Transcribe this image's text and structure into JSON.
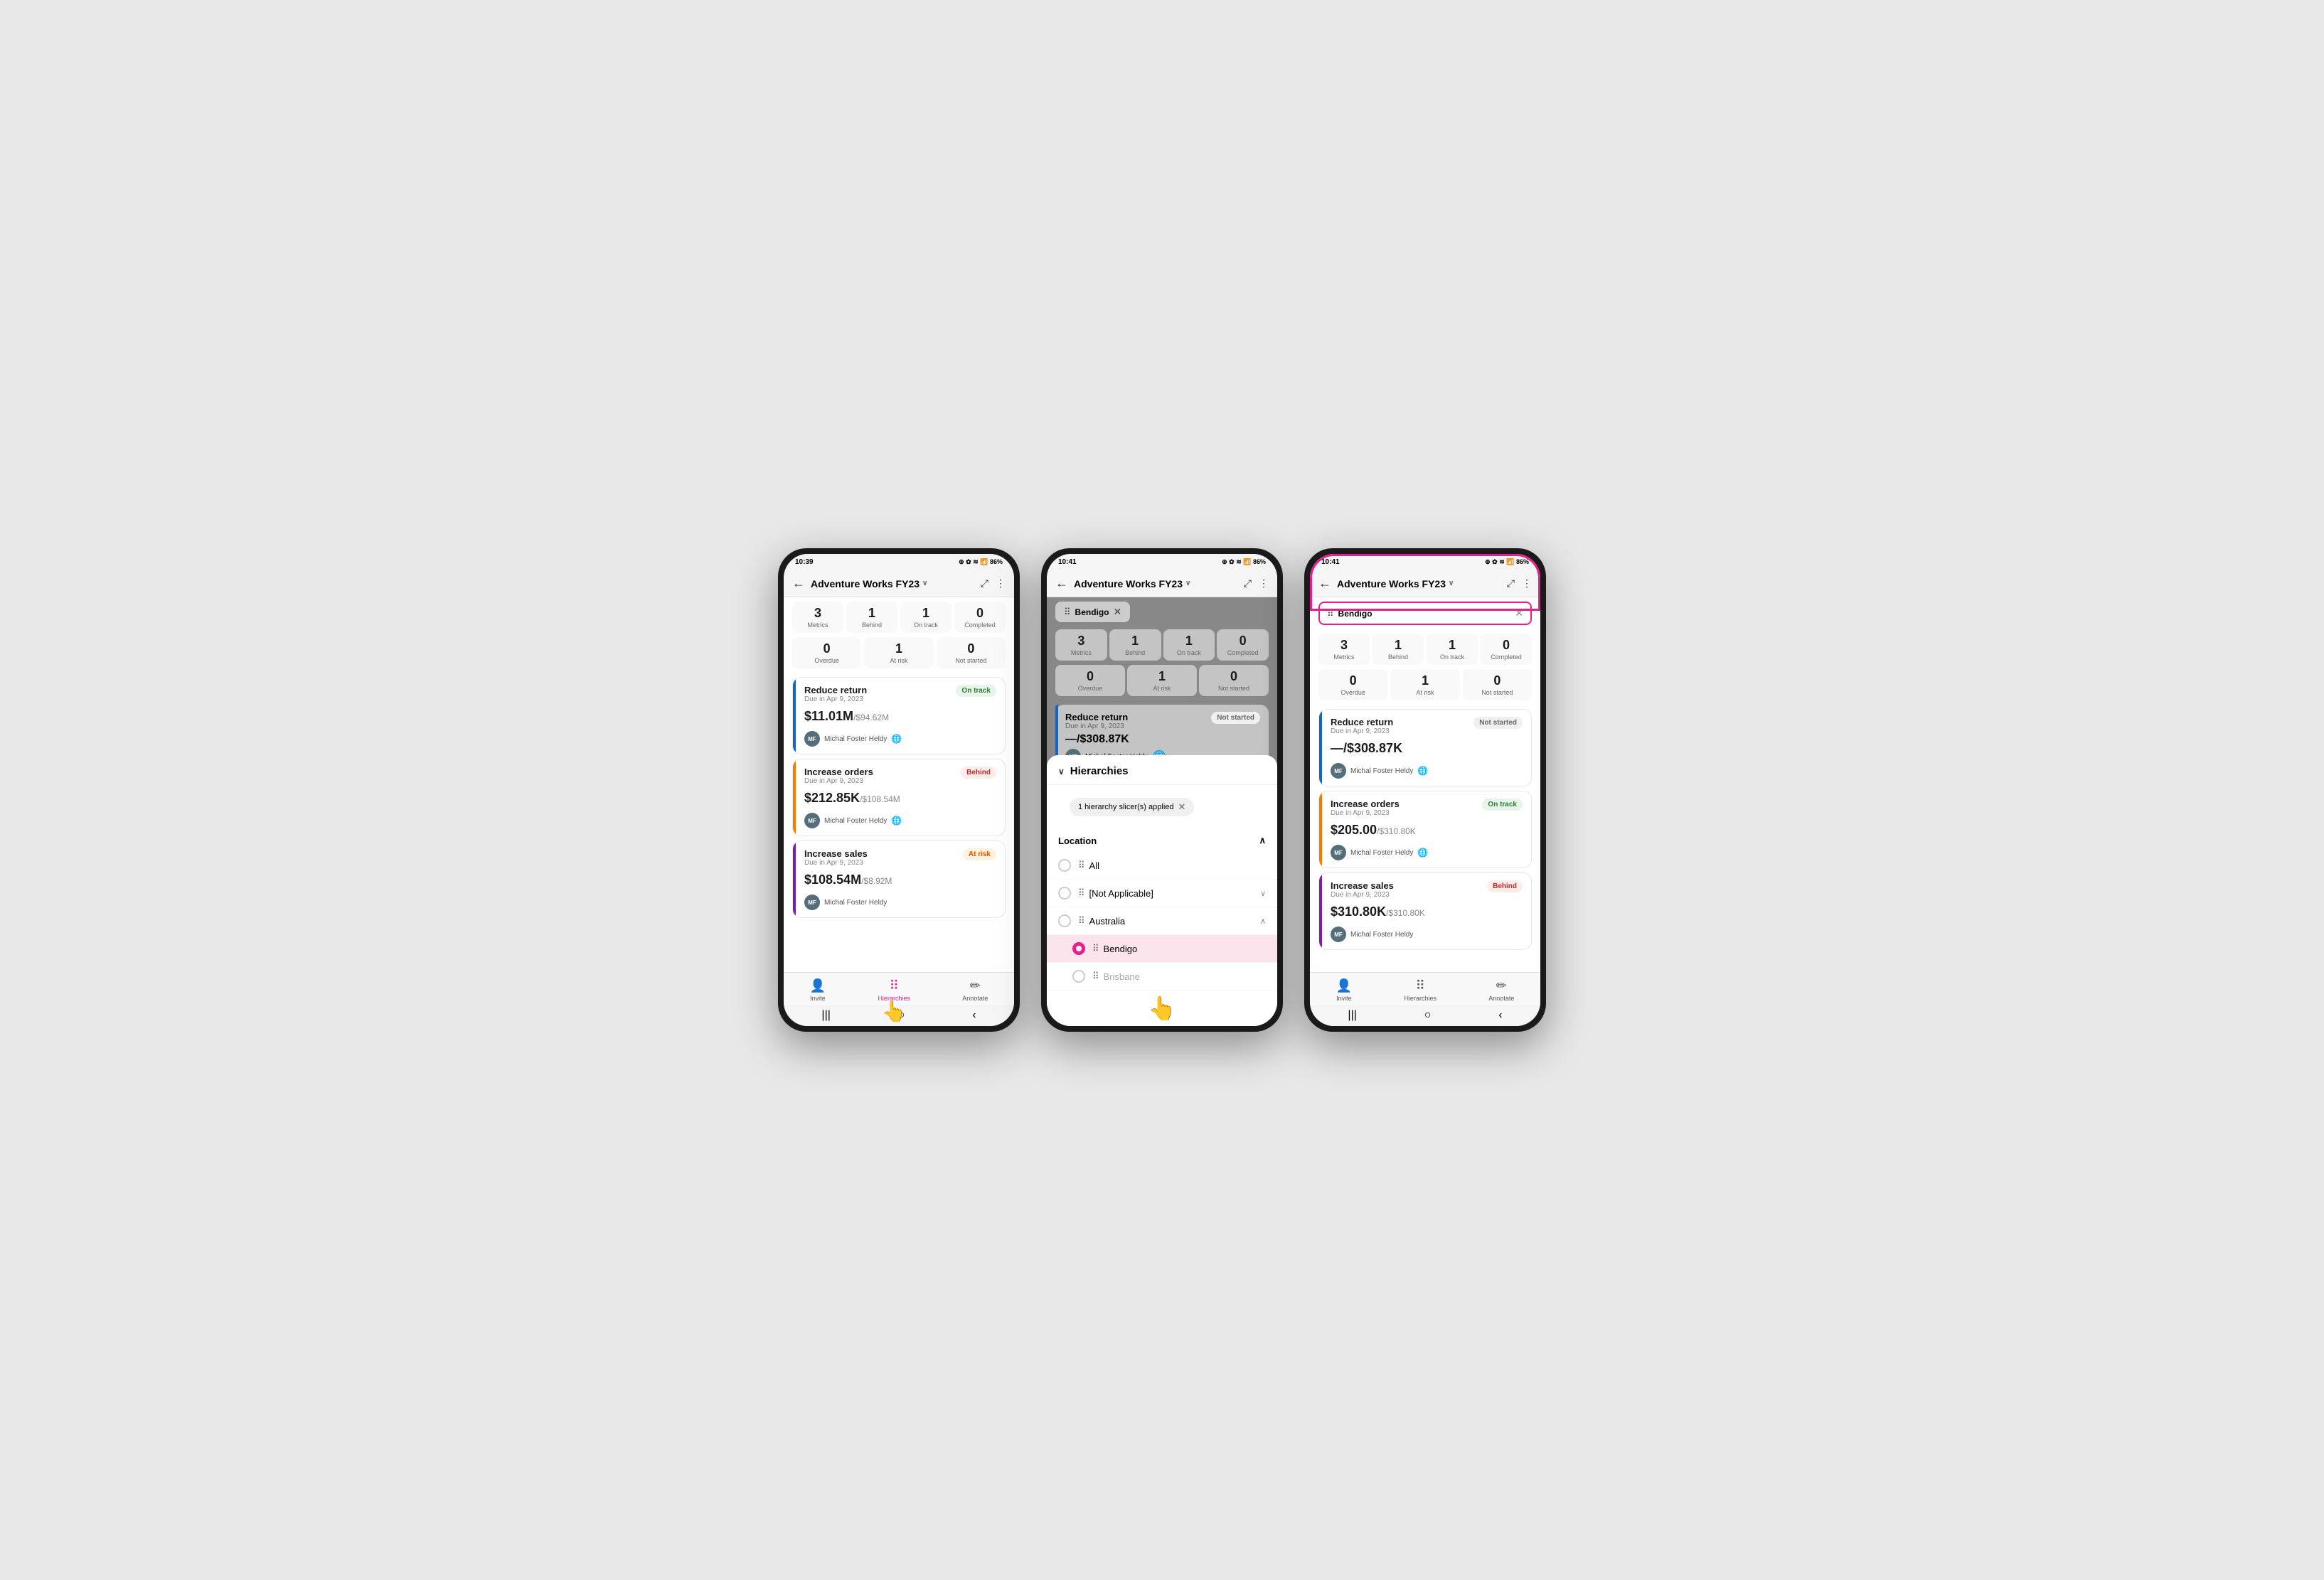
{
  "phones": [
    {
      "id": "phone1",
      "statusBar": {
        "time": "10:39",
        "icons": "⊕ ⓑ ✿ ≋ ∿ᵢₗ 86%"
      },
      "navBar": {
        "back": "←",
        "title": "Adventure Works FY23",
        "chevron": "∨",
        "expand": "⤢",
        "more": "⋮"
      },
      "metricsRow1": [
        {
          "value": "3",
          "label": "Metrics"
        },
        {
          "value": "1",
          "label": "Behind"
        },
        {
          "value": "1",
          "label": "On track"
        },
        {
          "value": "0",
          "label": "Completed"
        }
      ],
      "metricsRow2": [
        {
          "value": "0",
          "label": "Overdue"
        },
        {
          "value": "1",
          "label": "At risk"
        },
        {
          "value": "0",
          "label": "Not started"
        }
      ],
      "goals": [
        {
          "title": "Reduce return",
          "due": "Due in Apr 9, 2023",
          "status": "On track",
          "statusClass": "status-on-track",
          "amount": "$11.01M",
          "amountTarget": "/$94.62M",
          "owner": "Michal Foster Heldy",
          "colorClass": "goal-card-blue"
        },
        {
          "title": "Increase orders",
          "due": "Due in Apr 9, 2023",
          "status": "Behind",
          "statusClass": "status-behind",
          "amount": "$212.85K",
          "amountTarget": "/$108.54M",
          "owner": "Michal Foster Heldy",
          "colorClass": "goal-card-orange"
        },
        {
          "title": "Increase sales",
          "due": "Due in Apr 9, 2023",
          "status": "At risk",
          "statusClass": "status-at-risk",
          "amount": "$108.54M",
          "amountTarget": "/$8.92M",
          "owner": "Michal Foster Heldy",
          "colorClass": "goal-card-purple"
        }
      ],
      "bottomNav": [
        {
          "label": "Invite",
          "icon": "👤",
          "active": false
        },
        {
          "label": "Hierarchies",
          "icon": "⠿",
          "active": true
        },
        {
          "label": "Annotate",
          "icon": "✏",
          "active": false
        }
      ]
    },
    {
      "id": "phone2",
      "statusBar": {
        "time": "10:41",
        "icons": "⊕ ⓑ ✿ ≋ ∿ᵢₗ 86%"
      },
      "navBar": {
        "back": "←",
        "title": "Adventure Works FY23",
        "chevron": "∨",
        "expand": "⤢",
        "more": "⋮"
      },
      "filterChip": "Bendigo",
      "metricsRow1": [
        {
          "value": "3",
          "label": "Metrics"
        },
        {
          "value": "1",
          "label": "Behind"
        },
        {
          "value": "1",
          "label": "On track"
        },
        {
          "value": "0",
          "label": "Completed"
        }
      ],
      "metricsRow2": [
        {
          "value": "0",
          "label": "Overdue"
        },
        {
          "value": "1",
          "label": "At risk"
        },
        {
          "value": "0",
          "label": "Not started"
        }
      ],
      "overlayGoal": {
        "title": "Reduce return",
        "due": "Due in Apr 9, 2023",
        "status": "Not started",
        "amount": "—/$308.87K",
        "owner": "Michal Foster Heldy"
      },
      "hierarchyPanel": {
        "title": "Hierarchies",
        "appliedText": "1 hierarchy slicer(s) applied",
        "locationLabel": "Location",
        "options": [
          {
            "label": "All",
            "type": "all",
            "selected": false
          },
          {
            "label": "[Not Applicable]",
            "type": "group",
            "selected": false,
            "hasChevron": true
          },
          {
            "label": "Australia",
            "type": "group",
            "selected": false,
            "hasChevron": true,
            "expanded": true
          },
          {
            "label": "Bendigo",
            "type": "item",
            "selected": true
          },
          {
            "label": "Brisbane",
            "type": "item",
            "selected": false
          }
        ]
      },
      "bottomNav": [
        {
          "label": "Invite",
          "icon": "👤",
          "active": false
        },
        {
          "label": "Hierarchies",
          "icon": "⠿",
          "active": true
        },
        {
          "label": "Annotate",
          "icon": "✏",
          "active": false
        }
      ]
    },
    {
      "id": "phone3",
      "statusBar": {
        "time": "10:41",
        "icons": "⊕ ⓑ ✿ ≋ ∿ᵢₗ 86%"
      },
      "navBar": {
        "back": "←",
        "title": "Adventure Works FY23",
        "chevron": "∨",
        "expand": "⤢",
        "more": "⋮"
      },
      "filterChip": "Bendigo",
      "metricsRow1": [
        {
          "value": "3",
          "label": "Metrics"
        },
        {
          "value": "1",
          "label": "Behind"
        },
        {
          "value": "1",
          "label": "On track"
        },
        {
          "value": "0",
          "label": "Completed"
        }
      ],
      "metricsRow2": [
        {
          "value": "0",
          "label": "Overdue"
        },
        {
          "value": "1",
          "label": "At risk"
        },
        {
          "value": "0",
          "label": "Not started"
        }
      ],
      "goals": [
        {
          "title": "Reduce return",
          "due": "Due in Apr 9, 2023",
          "status": "Not started",
          "statusClass": "status-not-started",
          "amount": "—/$308.87K",
          "amountTarget": "",
          "owner": "Michal Foster Heldy",
          "colorClass": "goal-card-blue"
        },
        {
          "title": "Increase orders",
          "due": "Due in Apr 9, 2023",
          "status": "On track",
          "statusClass": "status-on-track",
          "amount": "$205.00",
          "amountTarget": "/$310.80K",
          "owner": "Michal Foster Heldy",
          "colorClass": "goal-card-orange"
        },
        {
          "title": "Increase sales",
          "due": "Due in Apr 9, 2023",
          "status": "Behind",
          "statusClass": "status-behind",
          "amount": "$310.80K",
          "amountTarget": "/$310.80K",
          "owner": "Michal Foster Heldy",
          "colorClass": "goal-card-purple"
        }
      ],
      "bottomNav": [
        {
          "label": "Invite",
          "icon": "👤",
          "active": false
        },
        {
          "label": "Hierarchies",
          "icon": "⠿",
          "active": false
        },
        {
          "label": "Annotate",
          "icon": "✏",
          "active": false
        }
      ],
      "highlighted": true
    }
  ]
}
